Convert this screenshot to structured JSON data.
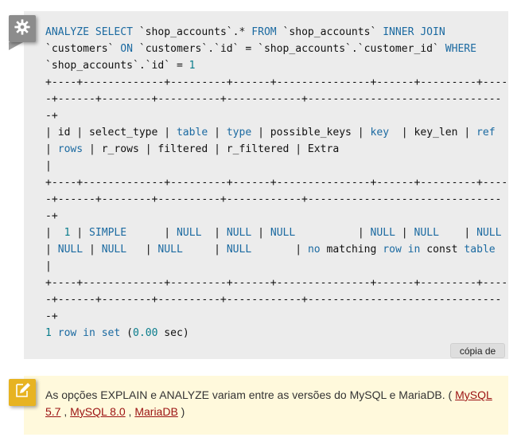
{
  "code_block": {
    "lines": [
      [
        {
          "t": "ANALYZE SELECT ",
          "c": "kw"
        },
        {
          "t": "`shop_accounts`.",
          "c": ""
        },
        {
          "t": "*",
          "c": "op"
        },
        {
          "t": " FROM ",
          "c": "kw"
        },
        {
          "t": "`shop_accounts` ",
          "c": ""
        },
        {
          "t": "INNER JOIN",
          "c": "kw"
        }
      ],
      [
        {
          "t": "`customers` ",
          "c": ""
        },
        {
          "t": "ON ",
          "c": "kw"
        },
        {
          "t": "`customers`.`id` = `shop_accounts`.`customer_id` ",
          "c": ""
        },
        {
          "t": "WHERE",
          "c": "kw"
        }
      ],
      [
        {
          "t": "`shop_accounts`.`id` = ",
          "c": ""
        },
        {
          "t": "1",
          "c": "num"
        }
      ],
      [
        {
          "t": "+----+-------------+---------+------+---------------+------+---------+----",
          "c": ""
        }
      ],
      [
        {
          "t": "-+------+--------+----------+------------+-------------------------------",
          "c": ""
        }
      ],
      [
        {
          "t": "-+",
          "c": ""
        }
      ],
      [
        {
          "t": "| id | select_type | ",
          "c": ""
        },
        {
          "t": "table",
          "c": "kw"
        },
        {
          "t": " | ",
          "c": ""
        },
        {
          "t": "type",
          "c": "kw"
        },
        {
          "t": " | possible_keys | ",
          "c": ""
        },
        {
          "t": "key",
          "c": "kw"
        },
        {
          "t": "  | key_len | ",
          "c": ""
        },
        {
          "t": "ref",
          "c": "kw"
        }
      ],
      [
        {
          "t": "| ",
          "c": ""
        },
        {
          "t": "rows",
          "c": "kw"
        },
        {
          "t": " | r_rows | filtered | r_filtered | Extra",
          "c": ""
        }
      ],
      [
        {
          "t": "|",
          "c": ""
        }
      ],
      [
        {
          "t": "+----+-------------+---------+------+---------------+------+---------+----",
          "c": ""
        }
      ],
      [
        {
          "t": "-+------+--------+----------+------------+-------------------------------",
          "c": ""
        }
      ],
      [
        {
          "t": "-+",
          "c": ""
        }
      ],
      [
        {
          "t": "|  ",
          "c": ""
        },
        {
          "t": "1",
          "c": "num"
        },
        {
          "t": " | ",
          "c": ""
        },
        {
          "t": "SIMPLE",
          "c": "kw"
        },
        {
          "t": "      | ",
          "c": ""
        },
        {
          "t": "NULL",
          "c": "kw"
        },
        {
          "t": "  | ",
          "c": ""
        },
        {
          "t": "NULL",
          "c": "kw"
        },
        {
          "t": " | ",
          "c": ""
        },
        {
          "t": "NULL",
          "c": "kw"
        },
        {
          "t": "          | ",
          "c": ""
        },
        {
          "t": "NULL",
          "c": "kw"
        },
        {
          "t": " | ",
          "c": ""
        },
        {
          "t": "NULL",
          "c": "kw"
        },
        {
          "t": "    | ",
          "c": ""
        },
        {
          "t": "NULL",
          "c": "kw"
        }
      ],
      [
        {
          "t": "| ",
          "c": ""
        },
        {
          "t": "NULL",
          "c": "kw"
        },
        {
          "t": " | ",
          "c": ""
        },
        {
          "t": "NULL",
          "c": "kw"
        },
        {
          "t": "   | ",
          "c": ""
        },
        {
          "t": "NULL",
          "c": "kw"
        },
        {
          "t": "     | ",
          "c": ""
        },
        {
          "t": "NULL",
          "c": "kw"
        },
        {
          "t": "       | ",
          "c": ""
        },
        {
          "t": "no",
          "c": "kw"
        },
        {
          "t": " matching ",
          "c": ""
        },
        {
          "t": "row",
          "c": "kw"
        },
        {
          "t": " ",
          "c": ""
        },
        {
          "t": "in",
          "c": "kw"
        },
        {
          "t": " const ",
          "c": ""
        },
        {
          "t": "table",
          "c": "kw"
        }
      ],
      [
        {
          "t": "|",
          "c": ""
        }
      ],
      [
        {
          "t": "+----+-------------+---------+------+---------------+------+---------+----",
          "c": ""
        }
      ],
      [
        {
          "t": "-+------+--------+----------+------------+-------------------------------",
          "c": ""
        }
      ],
      [
        {
          "t": "-+",
          "c": ""
        }
      ],
      [
        {
          "t": "1",
          "c": "num"
        },
        {
          "t": " ",
          "c": ""
        },
        {
          "t": "row in set",
          "c": "kw"
        },
        {
          "t": " (",
          "c": ""
        },
        {
          "t": "0.00",
          "c": "num"
        },
        {
          "t": " sec)",
          "c": ""
        }
      ]
    ],
    "copy_label": "cópia de",
    "icon": "gear-icon"
  },
  "note": {
    "icon": "pencil-icon",
    "text_before": "As opções EXPLAIN e ANALYZE variam entre as versões do MySQL e MariaDB. ( ",
    "links": [
      {
        "label": "MySQL 5.7"
      },
      {
        "label": "MySQL 8.0"
      },
      {
        "label": "MariaDB"
      }
    ],
    "separator": " , ",
    "text_after": " )"
  },
  "colors": {
    "keyword": "#1b6aa1",
    "number": "#0a7d8c",
    "link": "#9a1111",
    "code_bg": "#ececec",
    "note_bg": "#fff9dc"
  }
}
